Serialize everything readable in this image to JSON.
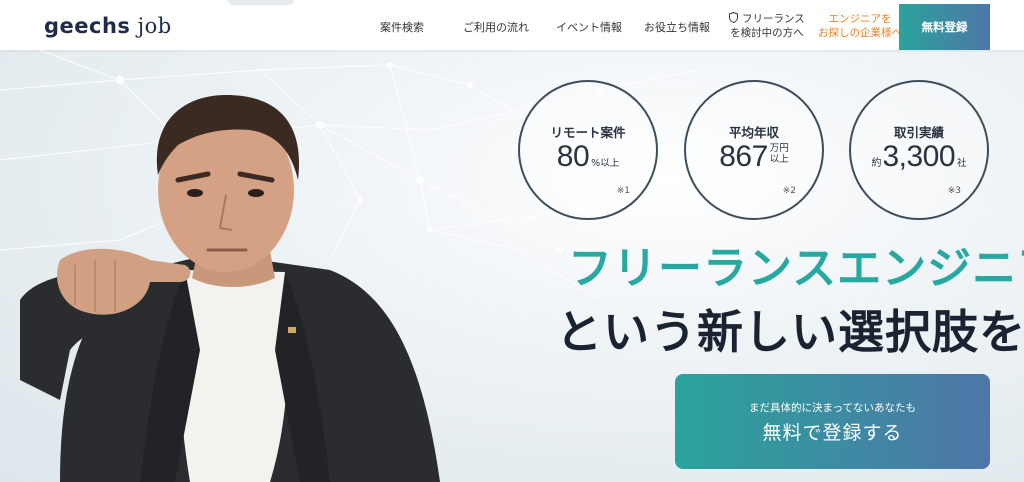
{
  "header": {
    "logo_main": "geechs",
    "logo_sub": "job",
    "nav": [
      "案件検索",
      "ご利用の流れ",
      "イベント情報",
      "お役立ち情報"
    ],
    "freelance_line1": "フリーランス",
    "freelance_line2": "を検討中の方へ",
    "corp_line1": "エンジニアを",
    "corp_line2": "お探しの企業様へ",
    "register": "無料登録"
  },
  "stats": [
    {
      "label": "リモート案件",
      "prefix": "",
      "value": "80",
      "suffix": "%以上",
      "note": "※1"
    },
    {
      "label": "平均年収",
      "prefix": "",
      "value": "867",
      "suffix_top": "万円",
      "suffix_bottom": "以上",
      "note": "※2"
    },
    {
      "label": "取引実績",
      "prefix": "約",
      "value": "3,300",
      "suffix": "社",
      "note": "※3"
    }
  ],
  "headline": {
    "line1": "フリーランスエンジニア",
    "line2": "という新しい選択肢を"
  },
  "cta": {
    "sub": "まだ具体的に決まってないあなたも",
    "main": "無料で登録する"
  },
  "colors": {
    "accent_teal": "#27a9a1",
    "accent_blue": "#4e76a8",
    "corp_orange": "#f0801e",
    "dark_text": "#1a2331"
  }
}
